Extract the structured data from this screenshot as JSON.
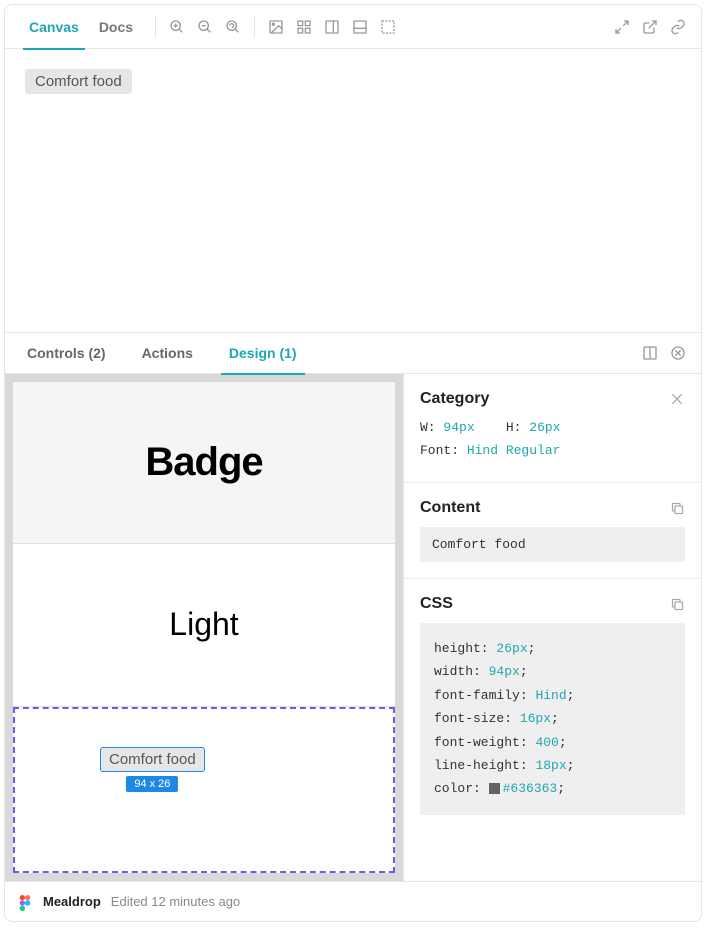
{
  "top_tabs": {
    "canvas": "Canvas",
    "docs": "Docs"
  },
  "badge_text": "Comfort food",
  "lower_tabs": {
    "controls": "Controls (2)",
    "actions": "Actions",
    "design": "Design (1)"
  },
  "design_cards": {
    "badge_label": "Badge",
    "light_label": "Light",
    "selected_text": "Comfort food",
    "selected_dim": "94 x 26"
  },
  "inspector": {
    "category_title": "Category",
    "w_label": "W:",
    "w_val": "94px",
    "h_label": "H:",
    "h_val": "26px",
    "font_label": "Font:",
    "font_val": "Hind Regular",
    "content_title": "Content",
    "content_value": "Comfort food",
    "css_title": "CSS",
    "css": {
      "height_p": "height:",
      "height_v": "26px",
      "width_p": "width:",
      "width_v": "94px",
      "ff_p": "font-family:",
      "ff_v": "Hind",
      "fs_p": "font-size:",
      "fs_v": "16px",
      "fw_p": "font-weight:",
      "fw_v": "400",
      "lh_p": "line-height:",
      "lh_v": "18px",
      "color_p": "color:",
      "color_v": "#636363"
    }
  },
  "footer": {
    "name": "Mealdrop",
    "sub": "Edited 12 minutes ago"
  }
}
